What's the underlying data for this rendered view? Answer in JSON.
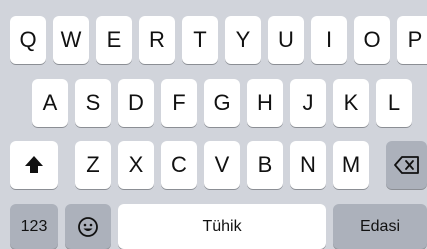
{
  "keyboard": {
    "row1": [
      "Q",
      "W",
      "E",
      "R",
      "T",
      "Y",
      "U",
      "I",
      "O",
      "P"
    ],
    "row2": [
      "A",
      "S",
      "D",
      "F",
      "G",
      "H",
      "J",
      "K",
      "L"
    ],
    "row3": [
      "Z",
      "X",
      "C",
      "V",
      "B",
      "N",
      "M"
    ],
    "shift_icon": "shift-arrow-icon",
    "delete_icon": "backspace-icon",
    "numbers_label": "123",
    "emoji_icon": "emoji-face-icon",
    "space_label": "Tühik",
    "return_label": "Edasi"
  },
  "colors": {
    "background": "#d1d4db",
    "letter_key": "#ffffff",
    "function_key": "#acb1bb",
    "text": "#111111"
  }
}
